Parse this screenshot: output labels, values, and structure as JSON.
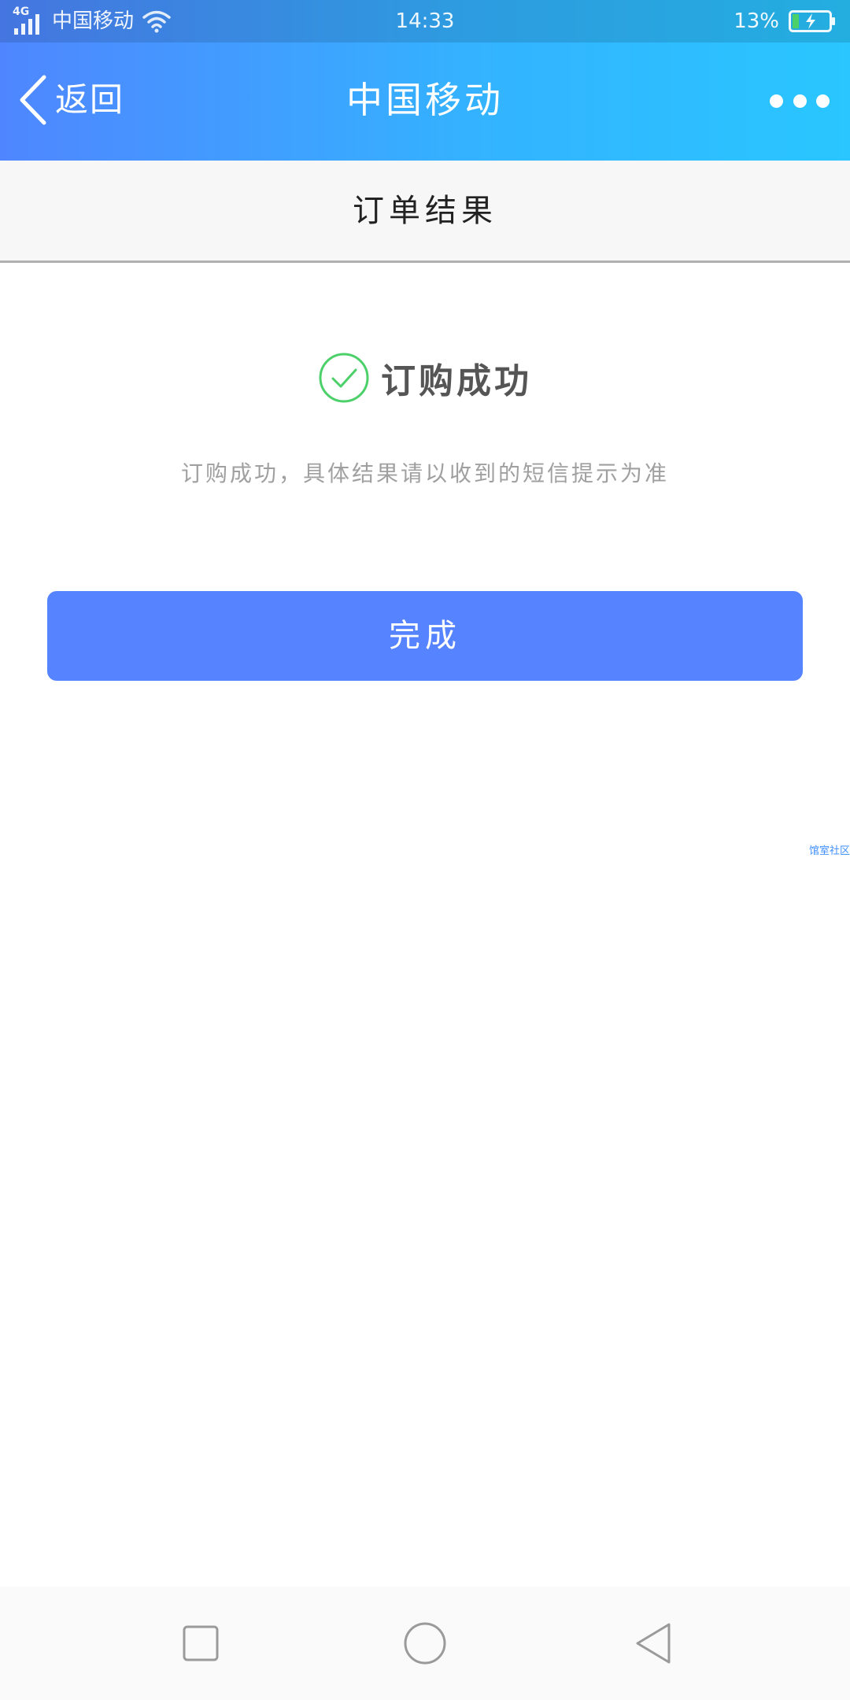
{
  "status_bar": {
    "network": "4G",
    "carrier": "中国移动",
    "time": "14:33",
    "battery": "13%"
  },
  "nav": {
    "back_label": "返回",
    "title": "中国移动"
  },
  "page": {
    "header_title": "订单结果"
  },
  "result": {
    "title": "订购成功",
    "description": "订购成功，具体结果请以收到的短信提示为准",
    "done_label": "完成",
    "watermark": "馆室社区"
  },
  "colors": {
    "gradient_start": "#4f86ff",
    "gradient_end": "#29c6ff",
    "primary_button": "#5683ff",
    "success_green": "#4cd06a"
  },
  "icons": {
    "back": "chevron-left-icon",
    "more": "more-dots-icon",
    "success": "check-circle-icon",
    "wifi": "wifi-icon",
    "signal": "signal-icon",
    "battery": "battery-charging-icon",
    "system_recents": "square-icon",
    "system_home": "circle-icon",
    "system_back": "triangle-back-icon"
  }
}
